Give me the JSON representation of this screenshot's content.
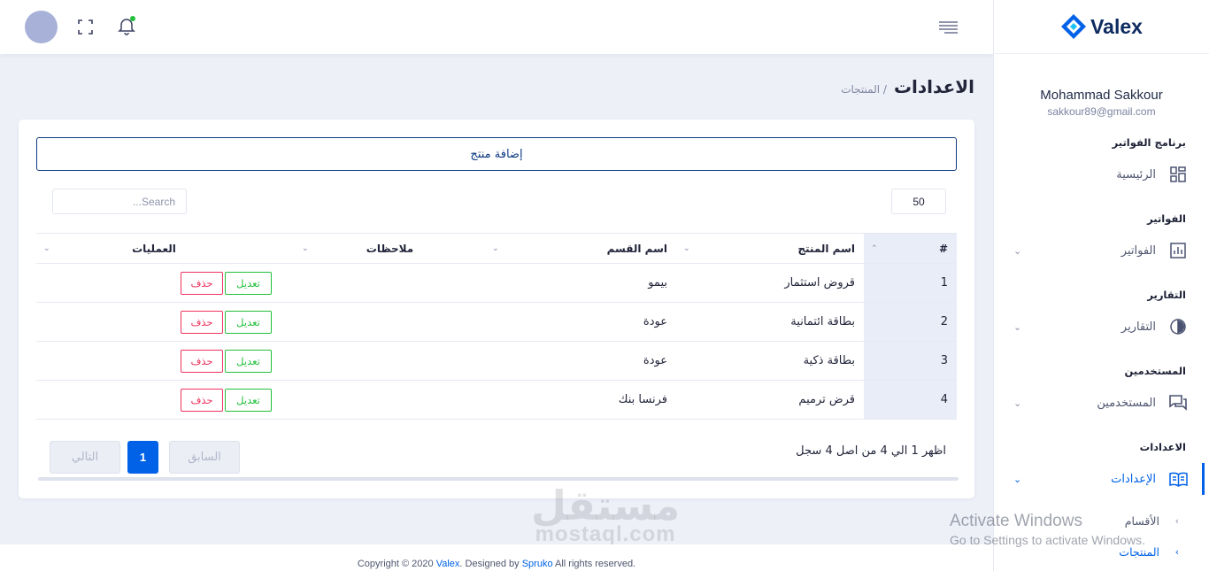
{
  "brand": {
    "name": "Valex"
  },
  "user": {
    "name": "Mohammad Sakkour",
    "email": "sakkour89@gmail.com"
  },
  "sidebar": {
    "sections": [
      {
        "title": "برنامج الفواتير",
        "item": "الرئيسية",
        "icon": "dashboard-icon"
      },
      {
        "title": "الفواتير",
        "item": "الفواتير",
        "icon": "invoice-chart-icon"
      },
      {
        "title": "التقارير",
        "item": "التقارير",
        "icon": "reports-pie-icon"
      },
      {
        "title": "المستخدمين",
        "item": "المستخدمين",
        "icon": "users-chat-icon"
      },
      {
        "title": "الاعدادات",
        "item": "الإعدادات",
        "icon": "settings-book-icon"
      }
    ],
    "subitems": [
      "الأقسام",
      "المنتجات"
    ]
  },
  "header": {
    "title": "الاعدادات",
    "breadcrumb": "/ المنتجات"
  },
  "toolbar": {
    "add_label": "إضافة منتج",
    "search_placeholder": "Search...",
    "page_length": "50"
  },
  "table": {
    "headers": [
      "#",
      "اسم المنتج",
      "اسم القسم",
      "ملاحظات",
      "العمليات"
    ],
    "rows": [
      {
        "num": "1",
        "product": "قروض استثمار",
        "section": "بيمو",
        "notes": ""
      },
      {
        "num": "2",
        "product": "بطاقة ائتمانية",
        "section": "عودة",
        "notes": ""
      },
      {
        "num": "3",
        "product": "بطاقة ذكية",
        "section": "عودة",
        "notes": ""
      },
      {
        "num": "4",
        "product": "قرض ترميم",
        "section": "فرنسا بنك",
        "notes": ""
      }
    ],
    "edit_label": "تعديل",
    "delete_label": "حذف"
  },
  "pagination": {
    "info": "اظهر 1 الي 4 من اصل 4 سجل",
    "prev": "السابق",
    "current": "1",
    "next": "التالي"
  },
  "footer": {
    "prefix": "Copyright © 2020 ",
    "brand_link": "Valex",
    "middle": ". Designed by ",
    "designer_link": "Spruko",
    "suffix": " All rights reserved."
  },
  "watermark": {
    "arabic": "مستقل",
    "english": "mostaql.com"
  },
  "activation": {
    "title": "Activate Windows",
    "subtitle": "Go to Settings to activate Windows."
  },
  "colors": {
    "primary": "#0162e8",
    "edit": "#22c03c",
    "delete": "#ee335e",
    "add_border": "#0e3a82"
  }
}
